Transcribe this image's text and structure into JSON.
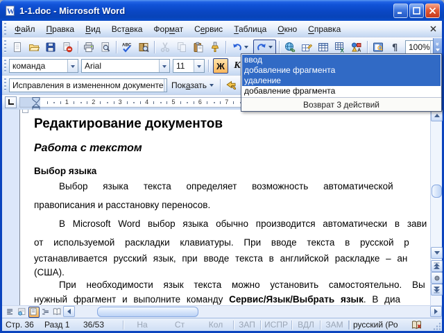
{
  "window": {
    "title": "1-1.doc - Microsoft Word"
  },
  "menu": {
    "items": [
      {
        "id": "file",
        "pre": "",
        "accel": "Ф",
        "post": "айл"
      },
      {
        "id": "edit",
        "pre": "",
        "accel": "П",
        "post": "равка"
      },
      {
        "id": "view",
        "pre": "",
        "accel": "В",
        "post": "ид"
      },
      {
        "id": "insert",
        "pre": "Вст",
        "accel": "а",
        "post": "вка"
      },
      {
        "id": "format",
        "pre": "Фор",
        "accel": "м",
        "post": "ат"
      },
      {
        "id": "tools",
        "pre": "С",
        "accel": "е",
        "post": "рвис"
      },
      {
        "id": "table",
        "pre": "",
        "accel": "Т",
        "post": "аблица"
      },
      {
        "id": "window",
        "pre": "",
        "accel": "О",
        "post": "кно"
      },
      {
        "id": "help",
        "pre": "",
        "accel": "С",
        "post": "правка"
      }
    ]
  },
  "toolbar_main": {
    "zoom_value": "100%",
    "buttons": [
      {
        "name": "new-document-icon"
      },
      {
        "name": "open-icon"
      },
      {
        "name": "save-icon"
      },
      {
        "name": "permission-icon"
      },
      {
        "sep": true
      },
      {
        "name": "print-icon"
      },
      {
        "name": "print-preview-icon"
      },
      {
        "sep": true
      },
      {
        "name": "spelling-icon"
      },
      {
        "name": "research-icon"
      },
      {
        "sep": true
      },
      {
        "name": "cut-icon",
        "disabled": true
      },
      {
        "name": "copy-icon",
        "disabled": true
      },
      {
        "name": "paste-icon"
      },
      {
        "name": "format-painter-icon"
      },
      {
        "sep": true
      },
      {
        "name": "undo-icon",
        "dropdown": true
      },
      {
        "name": "redo-icon",
        "dropdown": true,
        "pressed": true
      },
      {
        "sep": true
      },
      {
        "name": "hyperlink-icon"
      },
      {
        "name": "tables-borders-icon"
      },
      {
        "name": "insert-table-icon"
      },
      {
        "name": "insert-excel-icon"
      },
      {
        "name": "drawing-icon"
      },
      {
        "sep": true
      },
      {
        "name": "document-map-icon"
      },
      {
        "name": "pilcrow-icon"
      }
    ]
  },
  "toolbar_format": {
    "style_value": "команда",
    "font_value": "Arial",
    "size_value": "11",
    "bold_label": "Ж",
    "italic_label": "К"
  },
  "toolbar_review": {
    "mode_value": "Исправления в измененном документе",
    "show_pre": "Пок",
    "show_accel": "а",
    "show_post": "зать",
    "buttons": [
      {
        "name": "previous-change-icon"
      },
      {
        "name": "next-change-icon"
      }
    ]
  },
  "redo_dropdown": {
    "items": [
      {
        "label": "ввод",
        "selected": true
      },
      {
        "label": "добавление фрагмента",
        "selected": true
      },
      {
        "label": "удаление",
        "selected": true
      },
      {
        "label": "добавление фрагмента",
        "selected": false
      }
    ],
    "footer": "Возврат 3 действий"
  },
  "ruler": {
    "numbers": [
      "1",
      "2",
      "3",
      "4",
      "5",
      "6",
      "7"
    ]
  },
  "document": {
    "h1": "Редактирование документов",
    "h2": "Работа с текстом",
    "h3": "Выбор языка",
    "p1": [
      "Выбор языка текста определяет возможность автоматической",
      "правописания и расстановку переносов."
    ],
    "p2": [
      "В Microsoft Word выбор языка обычно производится автоматически в зави",
      "от используемой раскладки клавиатуры. При вводе текста в русской р",
      "устанавливается русский язык, при вводе текста в английской раскладке – ан",
      "(США)."
    ],
    "p3_line1": "При необходимости язык текста можно установить самостоятельно. Вы",
    "p3_line2": {
      "pre": "нужный фрагмент и выполните команду ",
      "bold": "Сервис/Язык/Выбрать ",
      "squiggle": "язык",
      "tail": ". В диа"
    }
  },
  "view_bar": {
    "buttons": [
      {
        "name": "normal-view-icon"
      },
      {
        "name": "web-layout-icon"
      },
      {
        "name": "print-layout-icon",
        "pressed": true
      },
      {
        "name": "outline-view-icon"
      },
      {
        "name": "reading-layout-icon"
      }
    ]
  },
  "status": {
    "fields": [
      {
        "id": "page",
        "label": "Стр. 36"
      },
      {
        "id": "section",
        "label": "Разд 1"
      },
      {
        "id": "position",
        "label": "36/53"
      },
      {
        "id": "at",
        "label": "На",
        "gray": true
      },
      {
        "id": "line",
        "label": "Ст",
        "gray": true
      },
      {
        "id": "column",
        "label": "Кол",
        "gray": true
      },
      {
        "id": "record-mode",
        "label": "ЗАП",
        "gray": true,
        "toggle": true
      },
      {
        "id": "track-changes",
        "label": "ИСПР",
        "gray": true,
        "toggle": true
      },
      {
        "id": "extend-selection",
        "label": "ВДЛ",
        "gray": true,
        "toggle": true
      },
      {
        "id": "overtype",
        "label": "ЗАМ",
        "gray": true,
        "toggle": true
      },
      {
        "id": "language",
        "label": "русский (Ро"
      }
    ]
  },
  "colors": {
    "selection": "#316AC5",
    "title_blue": "#0A49C8",
    "toggle_orange": "#FCB65B"
  }
}
